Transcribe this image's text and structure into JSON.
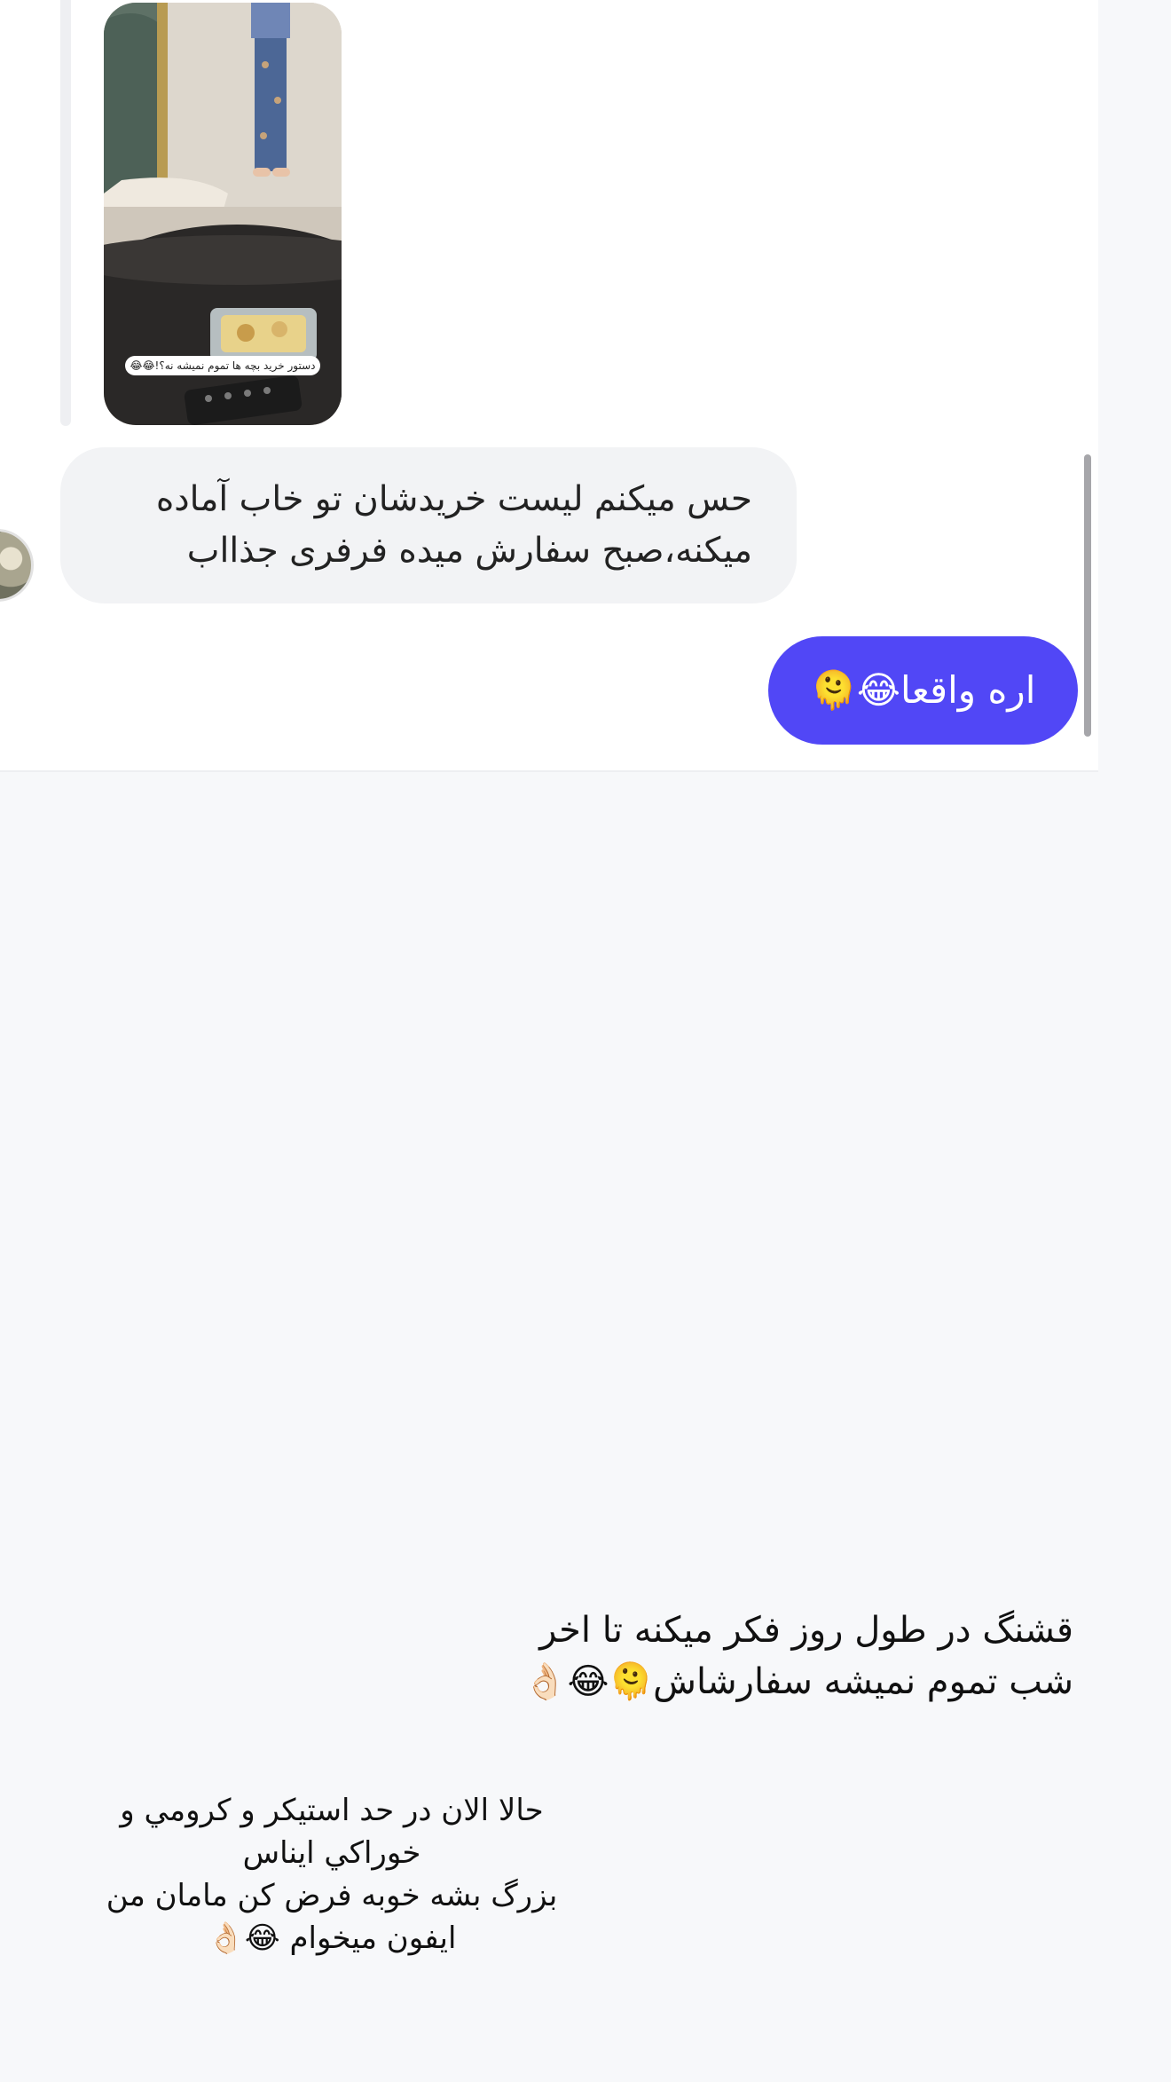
{
  "reply_media": {
    "caption": "دستور خرید بچه ها تموم نمیشه نه؟!😂😂"
  },
  "messages": {
    "incoming_lines": [
      "حس میکنم لیست خریدشان تو خاب آماده",
      "میکنه،صبح سفارش میده فرفری جذااب"
    ],
    "outgoing": "اره واقعا😂🫠"
  },
  "captions": {
    "right_lines": [
      "قشنگ در طول روز فکر میکنه تا اخر",
      "شب تموم نمیشه سفارشاش🫠😂👌🏻"
    ],
    "left_lines": [
      "حالا الان در حد استيكر و كرومي و",
      "خوراكي ايناس",
      "بزرگ بشه خوبه فرض كن مامان من",
      "ايفون ميخوام 😂👌🏻"
    ]
  },
  "colors": {
    "outgoing_bubble": "#5147f6",
    "incoming_bubble": "#f2f3f5",
    "page_background": "#f7f8fa"
  }
}
